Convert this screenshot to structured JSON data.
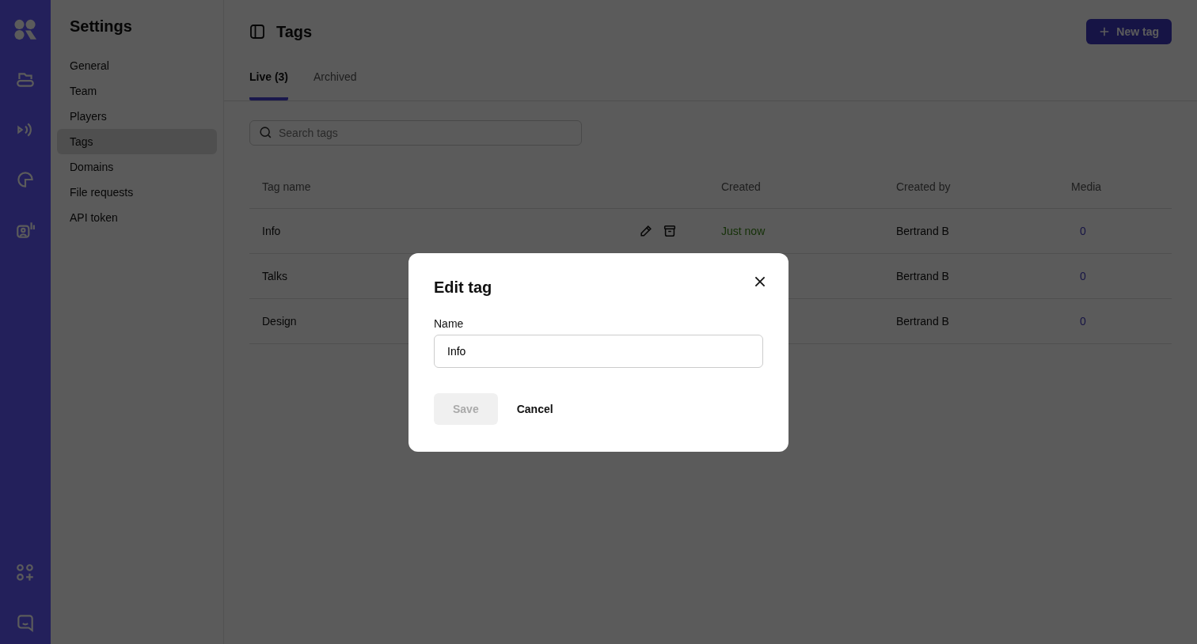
{
  "sidebar": {
    "title": "Settings",
    "items": [
      {
        "label": "General",
        "selected": false
      },
      {
        "label": "Team",
        "selected": false
      },
      {
        "label": "Players",
        "selected": false
      },
      {
        "label": "Tags",
        "selected": true
      },
      {
        "label": "Domains",
        "selected": false
      },
      {
        "label": "File requests",
        "selected": false
      },
      {
        "label": "API token",
        "selected": false
      }
    ]
  },
  "page": {
    "title": "Tags",
    "new_button": "New tag"
  },
  "tabs": [
    {
      "label": "Live (3)",
      "selected": true
    },
    {
      "label": "Archived",
      "selected": false
    }
  ],
  "search": {
    "placeholder": "Search tags"
  },
  "table": {
    "columns": [
      "Tag name",
      "Created",
      "Created by",
      "Media"
    ],
    "rows": [
      {
        "name": "Info",
        "actions_shown": true,
        "created": "Just now",
        "created_by": "Bertrand B",
        "media": "0"
      },
      {
        "name": "Talks",
        "created_by": "Bertrand B",
        "media": "0"
      },
      {
        "name": "Design",
        "created_by": "Bertrand B",
        "media": "0"
      }
    ]
  },
  "dialog": {
    "title": "Edit tag",
    "field_label": "Name",
    "value": "Info",
    "save": "Save",
    "save_disabled": true,
    "cancel": "Cancel"
  }
}
